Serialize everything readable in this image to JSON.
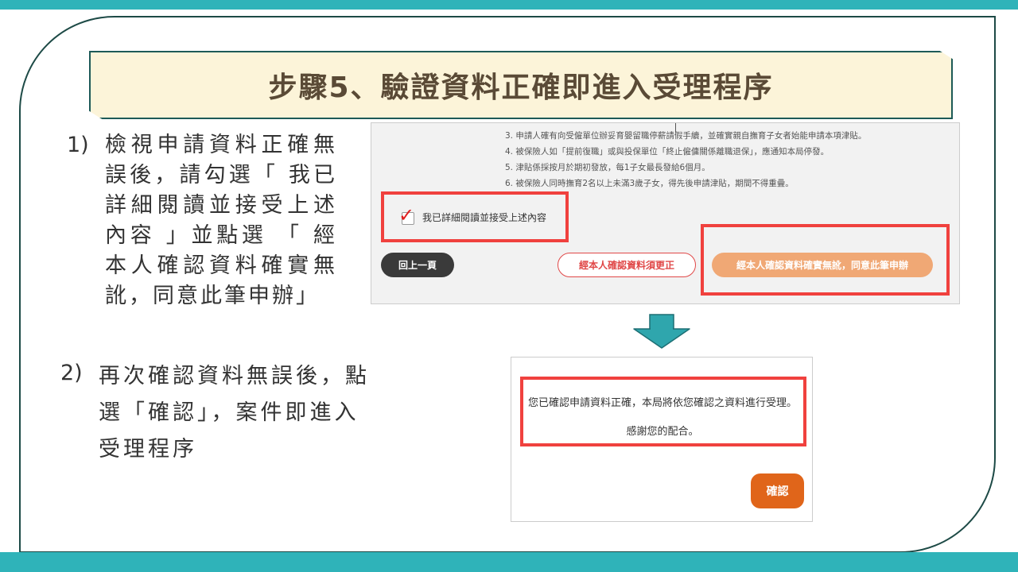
{
  "title": "步驟5、驗證資料正確即進入受理程序",
  "steps": [
    {
      "number": "1)",
      "text": "檢視申請資料正確無誤後，請勾選「 我已詳細閱讀並接受上述內容 」並點選 「 經本人確認資料確實無訛，同意此筆申辦」"
    },
    {
      "number": "2)",
      "text": "再次確認資料無誤後，點選「確認」，案件即進入受理程序"
    }
  ],
  "screenshot1": {
    "notes": [
      "3. 申請人確有向受僱單位辦妥育嬰留職停薪請假手續，並確實親自撫育子女者始能申請本項津貼。",
      "4. 被保險人如「提前復職」或與投保單位「終止僱傭關係離職退保」，應通知本局停發。",
      "5. 津貼係採按月於期初發放，每1子女最長發給6個月。",
      "6. 被保險人同時撫育2名以上未滿3歲子女，得先後申請津貼，期間不得重疊。"
    ],
    "checkbox_label": "我已詳細閱讀並接受上述內容",
    "checkbox_checked": true,
    "back_button": "回上一頁",
    "correct_button": "經本人確認資料須更正",
    "agree_button": "經本人確認資料確實無訛，同意此筆申辦"
  },
  "screenshot2": {
    "message_line1": "您已確認申請資料正確，本局將依您確認之資料進行受理。",
    "message_line2": "感謝您的配合。",
    "ok_button": "確認"
  },
  "colors": {
    "accent_teal": "#2fb3b9",
    "highlight_red": "#f0413e",
    "agree_orange": "#f0a875",
    "ok_orange": "#e0651a",
    "title_bg": "#fcf4d9"
  },
  "icons": {
    "check": "check-mark-icon",
    "arrow": "down-arrow-icon"
  }
}
